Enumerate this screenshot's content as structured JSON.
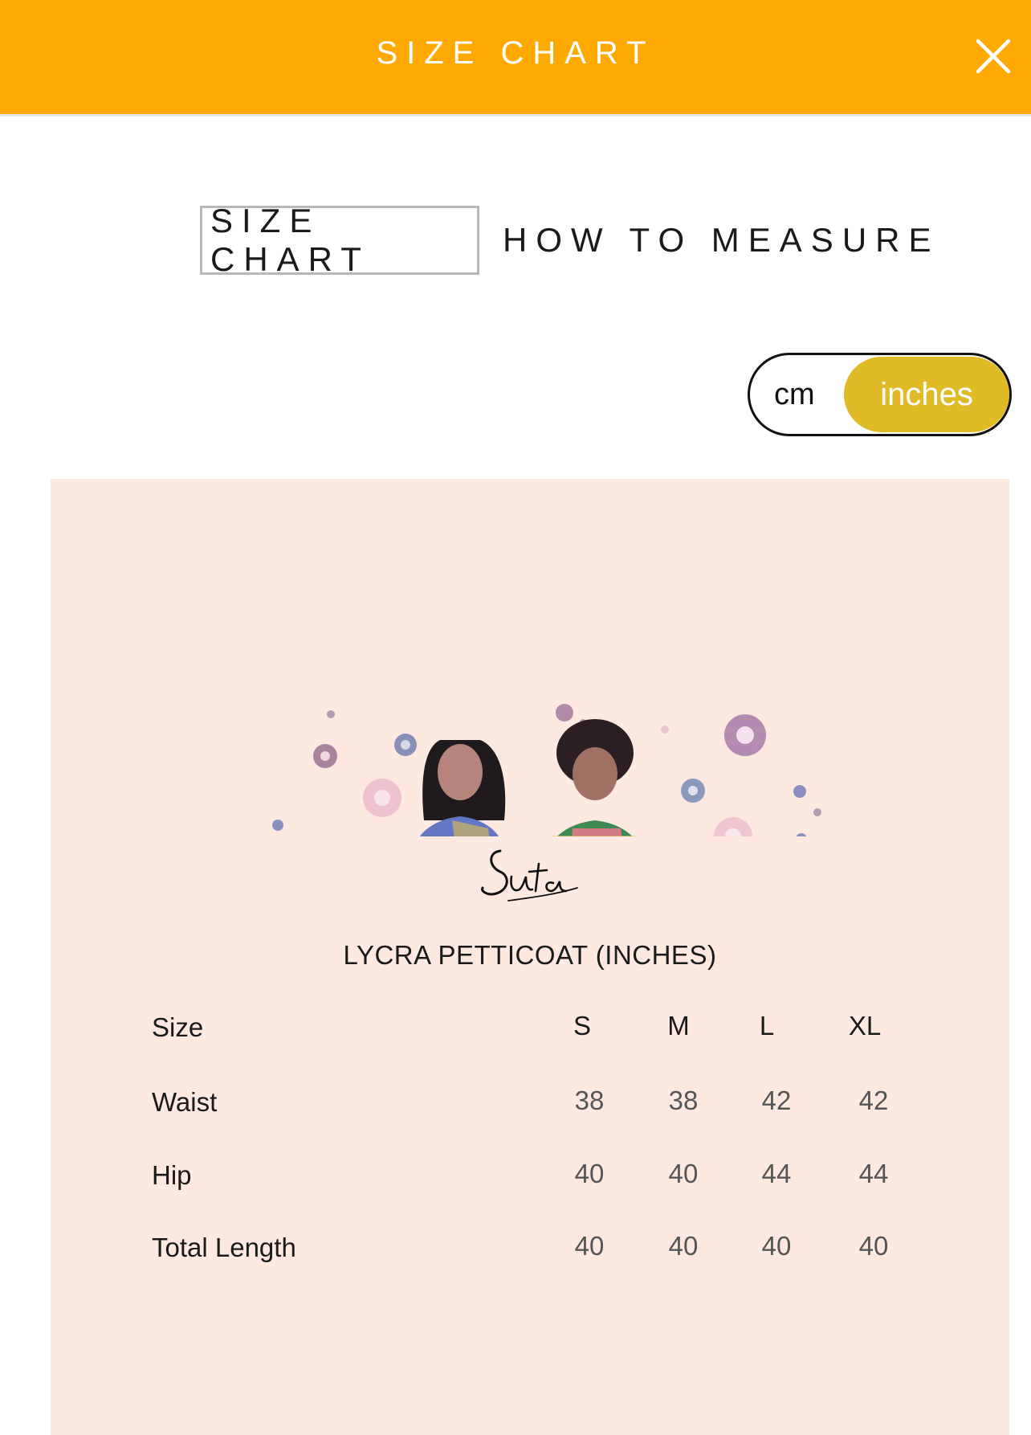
{
  "header": {
    "title": "SIZE CHART",
    "background_color": "#ffa903",
    "close_icon": "close-icon"
  },
  "tabs": [
    {
      "label": "SIZE CHART",
      "active": true
    },
    {
      "label": "HOW TO MEASURE",
      "active": false
    }
  ],
  "unit_toggle": {
    "options": [
      "cm",
      "inches"
    ],
    "selected": "inches",
    "accent_color": "#e1bb27"
  },
  "chart_card": {
    "background_color": "#fee9e0",
    "illustration": "two-women-at-desk-illustration",
    "brand_logo_text": "Suta",
    "title": "LYCRA PETTICOAT (INCHES)"
  },
  "size_table": {
    "header_label": "Size",
    "sizes": [
      "S",
      "M",
      "L",
      "XL"
    ],
    "rows": [
      {
        "label": "Waist",
        "values": [
          "38",
          "38",
          "42",
          "42"
        ]
      },
      {
        "label": "Hip",
        "values": [
          "40",
          "40",
          "44",
          "44"
        ]
      },
      {
        "label": "Total Length",
        "values": [
          "40",
          "40",
          "40",
          "40"
        ]
      }
    ]
  }
}
